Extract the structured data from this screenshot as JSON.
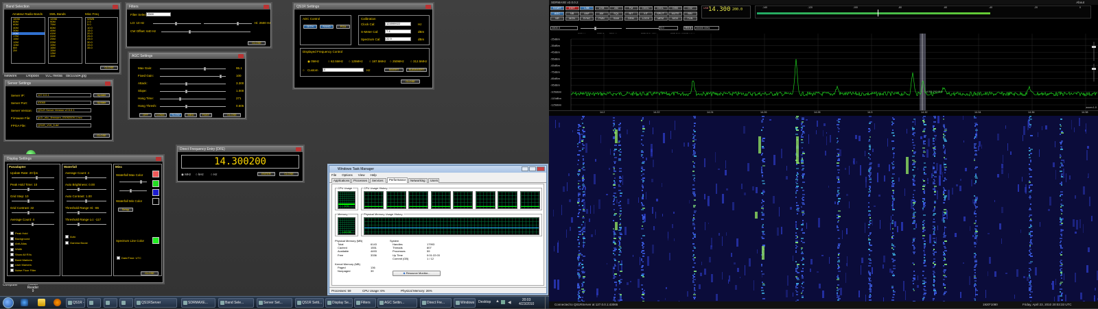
{
  "desktop": {
    "icons": [
      {
        "label": "Network"
      },
      {
        "label": "Dropbox"
      },
      {
        "label": "VLC media"
      },
      {
        "label": "dsc01684.jpg"
      },
      {
        "label": "Computer"
      },
      {
        "label": "Adobe Reader 9"
      }
    ]
  },
  "band_selection": {
    "title": "Band Selection",
    "col_amateur": "Amateur Radio Bands",
    "col_swl": "SWL Bands",
    "col_misc": "Misc Freq",
    "amateur": [
      "160M",
      "80M",
      "60M",
      "40M",
      "30M",
      "20M",
      "17M",
      "15M",
      "12M",
      "10M",
      "6M",
      "2M"
    ],
    "amateur_selected": 5,
    "swl": [
      "120M",
      "90M",
      "75M",
      "60M",
      "49M",
      "41M",
      "31M",
      "25M",
      "22M",
      "19M",
      "16M",
      "15M",
      "13M",
      "11M"
    ],
    "misc": [
      "WWB",
      "2.5",
      "5.0",
      "10.0",
      "15.0",
      "20.0",
      "25.0",
      "25.0",
      "30.0",
      "33.0",
      "35.0"
    ],
    "close": "CLOSE"
  },
  "filters": {
    "title": "Filters",
    "filter_select": "Filter Select:",
    "filter_value": "2500",
    "lo": "LO: 10 Hz",
    "hi": "Hi: 2500 Hz",
    "cw_offset": "CW Offset: 640 Hz",
    "close": "CLOSE"
  },
  "agc": {
    "title": "AGC Settings",
    "rows": [
      {
        "label": "Max Gain:",
        "value": "95.1"
      },
      {
        "label": "Fixed Gain:",
        "value": "100"
      },
      {
        "label": "Attack:",
        "value": "3.300"
      },
      {
        "label": "Slope:",
        "value": "1.000"
      },
      {
        "label": "Hang Time:",
        "value": "271"
      },
      {
        "label": "Hang Thresh:",
        "value": "0.605"
      }
    ],
    "buttons": [
      "OFF",
      "LONG",
      "SLOW",
      "MED",
      "FAST",
      "CLOSE"
    ]
  },
  "server": {
    "title": "Server Settings",
    "rows": [
      {
        "label": "Server IP:",
        "value": "127.0.0.1",
        "btn": "Update"
      },
      {
        "label": "Server Port:",
        "value": "43065",
        "btn": "Update"
      },
      {
        "label": "Server Version:",
        "value": "QSLR Server Version v2.5.0.1"
      },
      {
        "label": "Firmware File:",
        "value": "qs1r_ekc_firmware_03092009.1.hex"
      },
      {
        "label": "FPGA File:",
        "value": "QS1R_V19_5.rbf"
      }
    ],
    "close": "CLOSE"
  },
  "qs1r": {
    "title": "QS1R Settings",
    "adc_title": "ADC Control",
    "adc_buttons": [
      "DITH",
      "RAND",
      "PGA"
    ],
    "cal_title": "Calibration",
    "cal": [
      {
        "label": "Clock Cal:",
        "value": "124999922",
        "unit": "Hz"
      },
      {
        "label": "S-Meter Cal:",
        "value": "7.4",
        "unit": "dBm"
      },
      {
        "label": "Spectrum Cal:",
        "value": "22.9",
        "unit": "dBm"
      }
    ],
    "dfc_title": "Displayed Frequency Control",
    "dfc_options": [
      "0MHz",
      "62.5MHz",
      "125MHz",
      "187.5MHz",
      "250MHz",
      "312.5MHz"
    ],
    "custom_label": "Custom",
    "custom_value": "0",
    "custom_unit": "Hz",
    "btn_invert": "INVERT",
    "btn_subinvert": "SUBINVERT",
    "close": "CLOSE"
  },
  "display": {
    "title": "Display Settings",
    "panadapter_title": "Panadapter",
    "pan_rows": [
      "Update Rate: 20 fps",
      "Peak Hold Time: 10",
      "Grid Step: 10",
      "Grid Contrast: 32",
      "Average Count: 4"
    ],
    "checks": [
      "Peak Hold",
      "Background",
      "Anti-Alias",
      "Width",
      "Show All RXs",
      "Band Markers",
      "User Markers",
      "Noise Floor Filter"
    ],
    "waterfall_title": "Waterfall",
    "wf_rows": [
      "Average Count: 4",
      "Auto Brightness: 0.00",
      "Auto Contrast: 1.00",
      "Threshold Range Hi: -86",
      "Threshold Range Lo: -117"
    ],
    "wf_checks": [
      "Auto",
      "Gamma Boost"
    ],
    "misc_title": "Misc",
    "misc_labels": [
      "Waterfall Max Color",
      "Waterfall Min Color",
      "Spectrum Line Color"
    ],
    "setup": "Setup",
    "utc_check": "Date/Time: UTC",
    "close": "CLOSE",
    "colors": {
      "max": "#f05a5a",
      "mid": "#22dd22",
      "blue": "#1c1cd0",
      "min": "#000000",
      "line": "#22ee22"
    }
  },
  "dfe": {
    "title": "Direct Frequency Entry (DFE)",
    "value": "14.300200",
    "radios": [
      "MHz",
      "kHz",
      "Hz"
    ],
    "enter": "ENTER",
    "close": "CLOSE"
  },
  "taskmgr": {
    "title": "Windows Task Manager",
    "menu": [
      "File",
      "Options",
      "View",
      "Help"
    ],
    "tabs": [
      "Applications",
      "Processes",
      "Services",
      "Performance",
      "Networking",
      "Users"
    ],
    "active_tab": 3,
    "cpu_usage": "CPU Usage",
    "cpu_value": "6 %",
    "cpu_history": "CPU Usage History",
    "memory": "Memory",
    "memory_value": "1.60 GB",
    "mem_history": "Physical Memory Usage History",
    "phys_title": "Physical Memory (MB)",
    "phys": [
      {
        "k": "Total",
        "v": "6143"
      },
      {
        "k": "Cached",
        "v": "1551"
      },
      {
        "k": "Available",
        "v": "4493"
      },
      {
        "k": "Free",
        "v": "3336"
      }
    ],
    "kernel_title": "Kernel Memory (MB)",
    "kernel": [
      {
        "k": "Paged",
        "v": "136"
      },
      {
        "k": "Nonpaged",
        "v": "39"
      }
    ],
    "sys_title": "System",
    "sys": [
      {
        "k": "Handles",
        "v": "17993"
      },
      {
        "k": "Threads",
        "v": "807"
      },
      {
        "k": "Processes",
        "v": "59"
      },
      {
        "k": "Up Time",
        "v": "0:01:22:03"
      },
      {
        "k": "Commit (GB)",
        "v": "1 / 12"
      }
    ],
    "resmon": "Resource Monitor...",
    "status_processes": "Processes: 59",
    "status_cpu": "CPU Usage: 6%",
    "status_mem": "Physical Memory: 26%"
  },
  "taskbar": {
    "items": [
      "QS1R - Q...",
      "",
      "",
      "",
      "QS1RServer",
      "SDRMAXE...",
      "Band Sele...",
      "Server Set...",
      "QS1R Setti...",
      "Display Se...",
      "Filters",
      "AGC Settin...",
      "Direct Fre...",
      "Windows ..."
    ],
    "desktop": "Desktop",
    "time": "20:03",
    "date": "4/23/2010"
  },
  "sdr": {
    "title": "SDRMAXE v2.0.0.2",
    "title_right": "About",
    "top_buttons": [
      "START",
      "EXIT",
      "LSB",
      "USB",
      "AM",
      "FM",
      "DIGU",
      "DIGL",
      "DSB",
      "CW",
      "AGC",
      "NB",
      "ANF",
      "AM",
      "SQL",
      "RIT",
      "XIT",
      "SPLIT",
      "MUTE",
      "BIN",
      "NR",
      "MON",
      "SYNC",
      "FMN",
      "SAM",
      "DRM",
      "LOCK",
      "MEM",
      "MOX",
      "TUN"
    ],
    "freq_display": "14.300",
    "freq_small": "200.0",
    "band_label": "USB",
    "ctrl_left": "2800.0",
    "ctrl_mid": "5.0",
    "ctrl_rit": "RX 6",
    "ctrl_val": "28400 MHz",
    "spectrum_info": [
      "280kHz",
      "FFT-Span 250kHz",
      "FFT-BIN 40%",
      "FFT-BIN-WIDTH 6 Hz"
    ],
    "db_labels": [
      "-25dBm",
      "-35dBm",
      "-45dBm",
      "-55dBm",
      "-65dBm",
      "-75dBm",
      "-85dBm",
      "-95dBm",
      "-105dBm",
      "-115dBm",
      "-125dBm"
    ],
    "freq_ticks": [
      "14.2",
      "14.22",
      "14.24",
      "14.26",
      "14.28",
      "14.3",
      "14.32",
      "14.34",
      "14.36",
      "14.38"
    ],
    "smeter_ticks": [
      "-140",
      "-120",
      "-100",
      "-80",
      "-60",
      "-40",
      "-20",
      "0"
    ],
    "peak_label": "14.301.200 MHz",
    "zoom": "zoom:1.0",
    "status_left": "Connected to QS1RServer at 127.0.0.1:43065",
    "status_res": "1920*1080",
    "status_date": "Friday, April 23, 2010 20:03:33 UTC"
  }
}
